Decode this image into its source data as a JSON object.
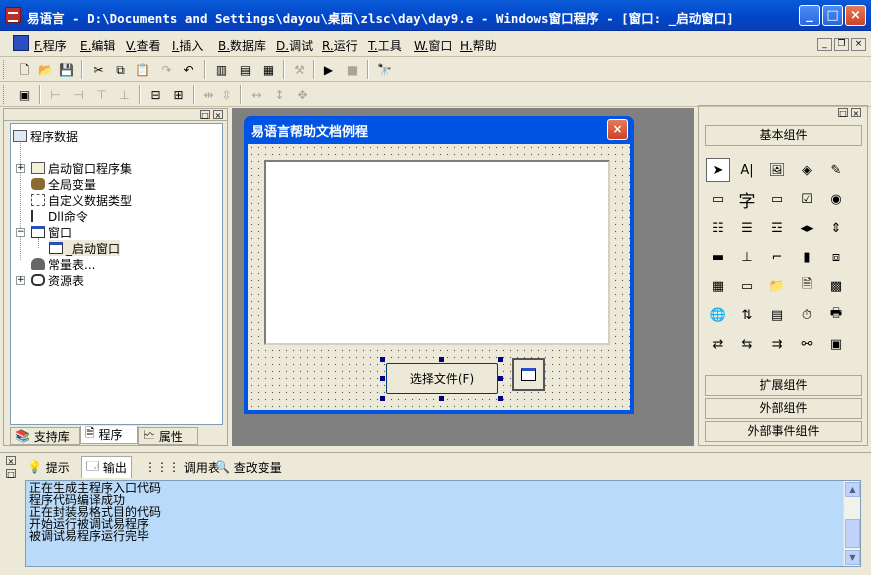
{
  "window": {
    "title": "易语言 - D:\\Documents and Settings\\dayou\\桌面\\zlsc\\day\\day9.e - Windows窗口程序 - [窗口: _启动窗口]"
  },
  "menu": {
    "items": [
      {
        "key": "F.",
        "label": "程序"
      },
      {
        "key": "E.",
        "label": "编辑"
      },
      {
        "key": "V.",
        "label": "查看"
      },
      {
        "key": "I.",
        "label": "插入"
      },
      {
        "key": "B.",
        "label": "数据库"
      },
      {
        "key": "D.",
        "label": "调试"
      },
      {
        "key": "R.",
        "label": "运行"
      },
      {
        "key": "T.",
        "label": "工具"
      },
      {
        "key": "W.",
        "label": "窗口"
      },
      {
        "key": "H.",
        "label": "帮助"
      }
    ]
  },
  "tree": {
    "items": [
      {
        "label": "程序数据"
      },
      {
        "label": "启动窗口程序集"
      },
      {
        "label": "全局变量"
      },
      {
        "label": "自定义数据类型"
      },
      {
        "label": "Dll命令"
      },
      {
        "label": "窗口"
      },
      {
        "label": "_启动窗口"
      },
      {
        "label": "常量表..."
      },
      {
        "label": "资源表"
      }
    ]
  },
  "left_tabs": [
    {
      "label": "支持库"
    },
    {
      "label": "程序"
    },
    {
      "label": "属性"
    }
  ],
  "form": {
    "title": "易语言帮助文档例程",
    "button_label": "选择文件(F)"
  },
  "right": {
    "basic_label": "基本组件",
    "ext_label": "扩展组件",
    "external_label": "外部组件",
    "external_event_label": "外部事件组件",
    "text_glyph": "字"
  },
  "bottom_tabs": [
    {
      "label": "提示"
    },
    {
      "label": "输出"
    },
    {
      "label": "调用表"
    },
    {
      "label": "查改变量"
    }
  ],
  "output": {
    "lines": [
      "正在生成主程序入口代码",
      "程序代码编译成功",
      "正在封装易格式目的代码",
      "开始运行被调试易程序",
      "被调试易程序运行完毕"
    ]
  },
  "colors": {
    "title_bar": "#0054e3",
    "output_bg": "#b9daf8",
    "app_icon": "#b92d2b"
  }
}
